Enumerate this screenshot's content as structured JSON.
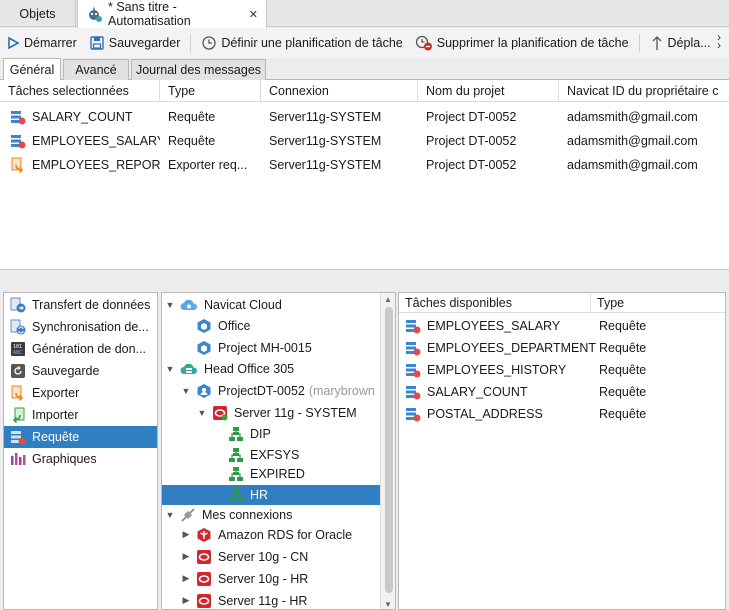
{
  "tabs": {
    "objects": "Objets",
    "automation": "* Sans titre - Automatisation"
  },
  "toolbar": {
    "start": "Démarrer",
    "save": "Sauvegarder",
    "set_schedule": "Définir une planification de tâche",
    "delete_schedule": "Supprimer la planification de tâche",
    "move": "Dépla..."
  },
  "subtabs": {
    "general": "Général",
    "advanced": "Avancé",
    "log": "Journal des messages"
  },
  "selected_tasks": {
    "columns": [
      "Tâches selectionnées",
      "Type",
      "Connexion",
      "Nom du projet",
      "Navicat ID du propriétaire c"
    ],
    "rows": [
      {
        "name": "SALARY_COUNT",
        "type": "Requête",
        "connection": "Server11g-SYSTEM",
        "project": "Project DT-0052",
        "owner": "adamsmith@gmail.com",
        "icon": "query-icon"
      },
      {
        "name": "EMPLOYEES_SALARY",
        "type": "Requête",
        "connection": "Server11g-SYSTEM",
        "project": "Project DT-0052",
        "owner": "adamsmith@gmail.com",
        "icon": "query-icon"
      },
      {
        "name": "EMPLOYEES_REPORT",
        "type": "Exporter req...",
        "connection": "Server11g-SYSTEM",
        "project": "Project DT-0052",
        "owner": "adamsmith@gmail.com",
        "icon": "export-icon"
      }
    ]
  },
  "categories": [
    {
      "label": "Transfert de données",
      "icon": "data-transfer-icon",
      "color": "#3a7fc4"
    },
    {
      "label": "Synchronisation de...",
      "icon": "data-sync-icon",
      "color": "#3a7fc4"
    },
    {
      "label": "Génération de don...",
      "icon": "data-generation-icon",
      "color": "#444444"
    },
    {
      "label": "Sauvegarde",
      "icon": "backup-icon",
      "color": "#555555"
    },
    {
      "label": "Exporter",
      "icon": "export-icon",
      "color": "#e58a1c"
    },
    {
      "label": "Importer",
      "icon": "import-icon",
      "color": "#3aa03a"
    },
    {
      "label": "Requête",
      "icon": "query-icon",
      "color": "#2f7fc2"
    },
    {
      "label": "Graphiques",
      "icon": "charts-icon",
      "color": "#9b3fb0"
    }
  ],
  "tree": {
    "navicat_cloud": "Navicat Cloud",
    "office": "Office",
    "project_mh": "Project MH-0015",
    "head_office": "Head Office 305",
    "project_dt": "ProjectDT-0052",
    "project_dt_owner": "(marybrown",
    "server11g_system": "Server 11g - SYSTEM",
    "schemas": [
      "DIP",
      "EXFSYS",
      "EXPIRED",
      "HR"
    ],
    "my_connections": "Mes connexions",
    "connections": [
      "Amazon RDS for Oracle",
      "Server 10g - CN",
      "Server 10g - HR",
      "Server 11g - HR"
    ]
  },
  "available_tasks": {
    "columns": [
      "Tâches disponibles",
      "Type"
    ],
    "rows": [
      {
        "name": "EMPLOYEES_SALARY",
        "type": "Requête"
      },
      {
        "name": "EMPLOYEES_DEPARTMENT",
        "type": "Requête"
      },
      {
        "name": "EMPLOYEES_HISTORY",
        "type": "Requête"
      },
      {
        "name": "SALARY_COUNT",
        "type": "Requête"
      },
      {
        "name": "POSTAL_ADDRESS",
        "type": "Requête"
      }
    ]
  },
  "colors": {
    "selection": "#2f7fc2",
    "oracle_red": "#d0262f",
    "schema_green": "#2f9a4a"
  }
}
